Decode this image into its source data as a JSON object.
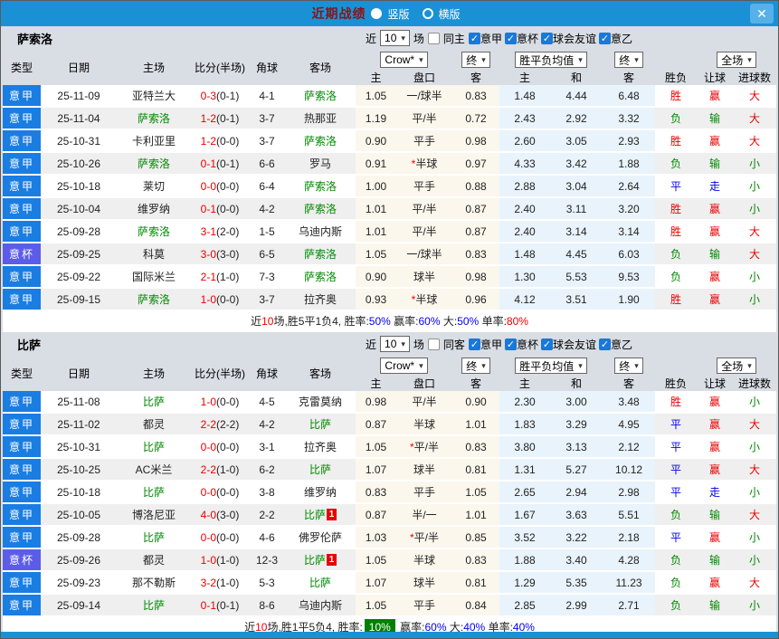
{
  "titlebar": {
    "title": "近期战绩",
    "radio_vertical": "竖版",
    "radio_horizontal": "横版"
  },
  "icons": {
    "close": "✕",
    "check": "✓",
    "caret": "▾"
  },
  "colors": {
    "titlebar_blue": "#1b91d5",
    "league_cell_blue": "#1a7de2",
    "cup_cell_purple": "#5c5ce8",
    "win_red": "#e80000",
    "lose_green": "#008800",
    "draw_blue": "#0000e8",
    "handicap_bg_cream": "#fbf7ed",
    "avg_bg_blue": "#e9f3fb",
    "rate_badge_green": "#008000"
  },
  "table_header": {
    "col_type": "类型",
    "col_date": "日期",
    "col_home": "主场",
    "col_score": "比分(半场)",
    "col_corner": "角球",
    "col_away": "客场",
    "sel_crow": "Crow*",
    "sel_final": "终",
    "sel_avg": "胜平负均值",
    "sel_final2": "终",
    "sel_full": "全场",
    "sub_home": "主",
    "sub_handicap": "盘口",
    "sub_away": "客",
    "sub_avg_home": "主",
    "sub_avg_draw": "和",
    "sub_avg_away": "客",
    "col_result": "胜负",
    "col_let": "让球",
    "col_goals": "进球数"
  },
  "sections": [
    {
      "team": "萨索洛",
      "filter": {
        "near": "近",
        "count": "10",
        "games": "场",
        "same": "同主",
        "same_checked": false,
        "leagues": [
          {
            "label": "意甲",
            "checked": true
          },
          {
            "label": "意杯",
            "checked": true
          },
          {
            "label": "球会友谊",
            "checked": true
          },
          {
            "label": "意乙",
            "checked": true
          }
        ]
      },
      "rows": [
        {
          "type": "意甲",
          "cup": false,
          "date": "25-11-09",
          "home": "亚特兰大",
          "home_c": "k",
          "home_badge": "",
          "score_ft": "0-3",
          "score_ht": "(0-1)",
          "corners": "4-1",
          "away": "萨索洛",
          "away_c": "g",
          "away_badge": "",
          "odds_home": "1.05",
          "handicap_star": "",
          "handicap": "一/球半",
          "odds_away": "0.83",
          "avg_win": "1.48",
          "avg_draw": "4.44",
          "avg_lose": "6.48",
          "result": "胜",
          "result_c": "r",
          "let_result": "赢",
          "let_c": "r",
          "goals": "大",
          "goals_c": "r"
        },
        {
          "type": "意甲",
          "cup": false,
          "date": "25-11-04",
          "home": "萨索洛",
          "home_c": "g",
          "home_badge": "",
          "score_ft": "1-2",
          "score_ht": "(0-1)",
          "corners": "3-7",
          "away": "热那亚",
          "away_c": "k",
          "away_badge": "",
          "odds_home": "1.19",
          "handicap_star": "",
          "handicap": "平/半",
          "odds_away": "0.72",
          "avg_win": "2.43",
          "avg_draw": "2.92",
          "avg_lose": "3.32",
          "result": "负",
          "result_c": "g",
          "let_result": "输",
          "let_c": "g",
          "goals": "大",
          "goals_c": "r"
        },
        {
          "type": "意甲",
          "cup": false,
          "date": "25-10-31",
          "home": "卡利亚里",
          "home_c": "k",
          "home_badge": "",
          "score_ft": "1-2",
          "score_ht": "(0-0)",
          "corners": "3-7",
          "away": "萨索洛",
          "away_c": "g",
          "away_badge": "",
          "odds_home": "0.90",
          "handicap_star": "",
          "handicap": "平手",
          "odds_away": "0.98",
          "avg_win": "2.60",
          "avg_draw": "3.05",
          "avg_lose": "2.93",
          "result": "胜",
          "result_c": "r",
          "let_result": "赢",
          "let_c": "r",
          "goals": "大",
          "goals_c": "r"
        },
        {
          "type": "意甲",
          "cup": false,
          "date": "25-10-26",
          "home": "萨索洛",
          "home_c": "g",
          "home_badge": "",
          "score_ft": "0-1",
          "score_ht": "(0-1)",
          "corners": "6-6",
          "away": "罗马",
          "away_c": "k",
          "away_badge": "",
          "odds_home": "0.91",
          "handicap_star": "*",
          "handicap": "半球",
          "odds_away": "0.97",
          "avg_win": "4.33",
          "avg_draw": "3.42",
          "avg_lose": "1.88",
          "result": "负",
          "result_c": "g",
          "let_result": "输",
          "let_c": "g",
          "goals": "小",
          "goals_c": "g"
        },
        {
          "type": "意甲",
          "cup": false,
          "date": "25-10-18",
          "home": "莱切",
          "home_c": "k",
          "home_badge": "",
          "score_ft": "0-0",
          "score_ht": "(0-0)",
          "corners": "6-4",
          "away": "萨索洛",
          "away_c": "g",
          "away_badge": "",
          "odds_home": "1.00",
          "handicap_star": "",
          "handicap": "平手",
          "odds_away": "0.88",
          "avg_win": "2.88",
          "avg_draw": "3.04",
          "avg_lose": "2.64",
          "result": "平",
          "result_c": "b",
          "let_result": "走",
          "let_c": "b",
          "goals": "小",
          "goals_c": "g"
        },
        {
          "type": "意甲",
          "cup": false,
          "date": "25-10-04",
          "home": "维罗纳",
          "home_c": "k",
          "home_badge": "",
          "score_ft": "0-1",
          "score_ht": "(0-0)",
          "corners": "4-2",
          "away": "萨索洛",
          "away_c": "g",
          "away_badge": "",
          "odds_home": "1.01",
          "handicap_star": "",
          "handicap": "平/半",
          "odds_away": "0.87",
          "avg_win": "2.40",
          "avg_draw": "3.11",
          "avg_lose": "3.20",
          "result": "胜",
          "result_c": "r",
          "let_result": "赢",
          "let_c": "r",
          "goals": "小",
          "goals_c": "g"
        },
        {
          "type": "意甲",
          "cup": false,
          "date": "25-09-28",
          "home": "萨索洛",
          "home_c": "g",
          "home_badge": "",
          "score_ft": "3-1",
          "score_ht": "(2-0)",
          "corners": "1-5",
          "away": "乌迪内斯",
          "away_c": "k",
          "away_badge": "",
          "odds_home": "1.01",
          "handicap_star": "",
          "handicap": "平/半",
          "odds_away": "0.87",
          "avg_win": "2.40",
          "avg_draw": "3.14",
          "avg_lose": "3.14",
          "result": "胜",
          "result_c": "r",
          "let_result": "赢",
          "let_c": "r",
          "goals": "大",
          "goals_c": "r"
        },
        {
          "type": "意杯",
          "cup": true,
          "date": "25-09-25",
          "home": "科莫",
          "home_c": "k",
          "home_badge": "",
          "score_ft": "3-0",
          "score_ht": "(3-0)",
          "corners": "6-5",
          "away": "萨索洛",
          "away_c": "g",
          "away_badge": "",
          "odds_home": "1.05",
          "handicap_star": "",
          "handicap": "一/球半",
          "odds_away": "0.83",
          "avg_win": "1.48",
          "avg_draw": "4.45",
          "avg_lose": "6.03",
          "result": "负",
          "result_c": "g",
          "let_result": "输",
          "let_c": "g",
          "goals": "大",
          "goals_c": "r"
        },
        {
          "type": "意甲",
          "cup": false,
          "date": "25-09-22",
          "home": "国际米兰",
          "home_c": "k",
          "home_badge": "",
          "score_ft": "2-1",
          "score_ht": "(1-0)",
          "corners": "7-3",
          "away": "萨索洛",
          "away_c": "g",
          "away_badge": "",
          "odds_home": "0.90",
          "handicap_star": "",
          "handicap": "球半",
          "odds_away": "0.98",
          "avg_win": "1.30",
          "avg_draw": "5.53",
          "avg_lose": "9.53",
          "result": "负",
          "result_c": "g",
          "let_result": "赢",
          "let_c": "r",
          "goals": "小",
          "goals_c": "g"
        },
        {
          "type": "意甲",
          "cup": false,
          "date": "25-09-15",
          "home": "萨索洛",
          "home_c": "g",
          "home_badge": "",
          "score_ft": "1-0",
          "score_ht": "(0-0)",
          "corners": "3-7",
          "away": "拉齐奥",
          "away_c": "k",
          "away_badge": "",
          "odds_home": "0.93",
          "handicap_star": "*",
          "handicap": "半球",
          "odds_away": "0.96",
          "avg_win": "4.12",
          "avg_draw": "3.51",
          "avg_lose": "1.90",
          "result": "胜",
          "result_c": "r",
          "let_result": "赢",
          "let_c": "r",
          "goals": "小",
          "goals_c": "g"
        }
      ],
      "summary": [
        {
          "text": "近",
          "c": "k"
        },
        {
          "text": "10",
          "c": "r"
        },
        {
          "text": "场,胜5平1负4, 胜率:",
          "c": "k"
        },
        {
          "text": "50%",
          "c": "b"
        },
        {
          "text": " 赢率:",
          "c": "k"
        },
        {
          "text": "60%",
          "c": "b"
        },
        {
          "text": " 大:",
          "c": "k"
        },
        {
          "text": "50%",
          "c": "b"
        },
        {
          "text": " 单率:",
          "c": "k"
        },
        {
          "text": "80%",
          "c": "r"
        }
      ]
    },
    {
      "team": "比萨",
      "filter": {
        "near": "近",
        "count": "10",
        "games": "场",
        "same": "同客",
        "same_checked": false,
        "leagues": [
          {
            "label": "意甲",
            "checked": true
          },
          {
            "label": "意杯",
            "checked": true
          },
          {
            "label": "球会友谊",
            "checked": true
          },
          {
            "label": "意乙",
            "checked": true
          }
        ]
      },
      "rows": [
        {
          "type": "意甲",
          "cup": false,
          "date": "25-11-08",
          "home": "比萨",
          "home_c": "g",
          "home_badge": "",
          "score_ft": "1-0",
          "score_ht": "(0-0)",
          "corners": "4-5",
          "away": "克雷莫纳",
          "away_c": "k",
          "away_badge": "",
          "odds_home": "0.98",
          "handicap_star": "",
          "handicap": "平/半",
          "odds_away": "0.90",
          "avg_win": "2.30",
          "avg_draw": "3.00",
          "avg_lose": "3.48",
          "result": "胜",
          "result_c": "r",
          "let_result": "赢",
          "let_c": "r",
          "goals": "小",
          "goals_c": "g"
        },
        {
          "type": "意甲",
          "cup": false,
          "date": "25-11-02",
          "home": "都灵",
          "home_c": "k",
          "home_badge": "",
          "score_ft": "2-2",
          "score_ht": "(2-2)",
          "corners": "4-2",
          "away": "比萨",
          "away_c": "g",
          "away_badge": "",
          "odds_home": "0.87",
          "handicap_star": "",
          "handicap": "半球",
          "odds_away": "1.01",
          "avg_win": "1.83",
          "avg_draw": "3.29",
          "avg_lose": "4.95",
          "result": "平",
          "result_c": "b",
          "let_result": "赢",
          "let_c": "r",
          "goals": "大",
          "goals_c": "r"
        },
        {
          "type": "意甲",
          "cup": false,
          "date": "25-10-31",
          "home": "比萨",
          "home_c": "g",
          "home_badge": "",
          "score_ft": "0-0",
          "score_ht": "(0-0)",
          "corners": "3-1",
          "away": "拉齐奥",
          "away_c": "k",
          "away_badge": "",
          "odds_home": "1.05",
          "handicap_star": "*",
          "handicap": "平/半",
          "odds_away": "0.83",
          "avg_win": "3.80",
          "avg_draw": "3.13",
          "avg_lose": "2.12",
          "result": "平",
          "result_c": "b",
          "let_result": "赢",
          "let_c": "r",
          "goals": "小",
          "goals_c": "g"
        },
        {
          "type": "意甲",
          "cup": false,
          "date": "25-10-25",
          "home": "AC米兰",
          "home_c": "k",
          "home_badge": "",
          "score_ft": "2-2",
          "score_ht": "(1-0)",
          "corners": "6-2",
          "away": "比萨",
          "away_c": "g",
          "away_badge": "",
          "odds_home": "1.07",
          "handicap_star": "",
          "handicap": "球半",
          "odds_away": "0.81",
          "avg_win": "1.31",
          "avg_draw": "5.27",
          "avg_lose": "10.12",
          "result": "平",
          "result_c": "b",
          "let_result": "赢",
          "let_c": "r",
          "goals": "大",
          "goals_c": "r"
        },
        {
          "type": "意甲",
          "cup": false,
          "date": "25-10-18",
          "home": "比萨",
          "home_c": "g",
          "home_badge": "",
          "score_ft": "0-0",
          "score_ht": "(0-0)",
          "corners": "3-8",
          "away": "维罗纳",
          "away_c": "k",
          "away_badge": "",
          "odds_home": "0.83",
          "handicap_star": "",
          "handicap": "平手",
          "odds_away": "1.05",
          "avg_win": "2.65",
          "avg_draw": "2.94",
          "avg_lose": "2.98",
          "result": "平",
          "result_c": "b",
          "let_result": "走",
          "let_c": "b",
          "goals": "小",
          "goals_c": "g"
        },
        {
          "type": "意甲",
          "cup": false,
          "date": "25-10-05",
          "home": "博洛尼亚",
          "home_c": "k",
          "home_badge": "",
          "score_ft": "4-0",
          "score_ht": "(3-0)",
          "corners": "2-2",
          "away": "比萨",
          "away_c": "g",
          "away_badge": "1",
          "odds_home": "0.87",
          "handicap_star": "",
          "handicap": "半/一",
          "odds_away": "1.01",
          "avg_win": "1.67",
          "avg_draw": "3.63",
          "avg_lose": "5.51",
          "result": "负",
          "result_c": "g",
          "let_result": "输",
          "let_c": "g",
          "goals": "大",
          "goals_c": "r"
        },
        {
          "type": "意甲",
          "cup": false,
          "date": "25-09-28",
          "home": "比萨",
          "home_c": "g",
          "home_badge": "",
          "score_ft": "0-0",
          "score_ht": "(0-0)",
          "corners": "4-6",
          "away": "佛罗伦萨",
          "away_c": "k",
          "away_badge": "",
          "odds_home": "1.03",
          "handicap_star": "*",
          "handicap": "平/半",
          "odds_away": "0.85",
          "avg_win": "3.52",
          "avg_draw": "3.22",
          "avg_lose": "2.18",
          "result": "平",
          "result_c": "b",
          "let_result": "赢",
          "let_c": "r",
          "goals": "小",
          "goals_c": "g"
        },
        {
          "type": "意杯",
          "cup": true,
          "date": "25-09-26",
          "home": "都灵",
          "home_c": "k",
          "home_badge": "",
          "score_ft": "1-0",
          "score_ht": "(1-0)",
          "corners": "12-3",
          "away": "比萨",
          "away_c": "g",
          "away_badge": "1",
          "odds_home": "1.05",
          "handicap_star": "",
          "handicap": "半球",
          "odds_away": "0.83",
          "avg_win": "1.88",
          "avg_draw": "3.40",
          "avg_lose": "4.28",
          "result": "负",
          "result_c": "g",
          "let_result": "输",
          "let_c": "g",
          "goals": "小",
          "goals_c": "g"
        },
        {
          "type": "意甲",
          "cup": false,
          "date": "25-09-23",
          "home": "那不勒斯",
          "home_c": "k",
          "home_badge": "",
          "score_ft": "3-2",
          "score_ht": "(1-0)",
          "corners": "5-3",
          "away": "比萨",
          "away_c": "g",
          "away_badge": "",
          "odds_home": "1.07",
          "handicap_star": "",
          "handicap": "球半",
          "odds_away": "0.81",
          "avg_win": "1.29",
          "avg_draw": "5.35",
          "avg_lose": "11.23",
          "result": "负",
          "result_c": "g",
          "let_result": "赢",
          "let_c": "r",
          "goals": "大",
          "goals_c": "r"
        },
        {
          "type": "意甲",
          "cup": false,
          "date": "25-09-14",
          "home": "比萨",
          "home_c": "g",
          "home_badge": "",
          "score_ft": "0-1",
          "score_ht": "(0-1)",
          "corners": "8-6",
          "away": "乌迪内斯",
          "away_c": "k",
          "away_badge": "",
          "odds_home": "1.05",
          "handicap_star": "",
          "handicap": "平手",
          "odds_away": "0.84",
          "avg_win": "2.85",
          "avg_draw": "2.99",
          "avg_lose": "2.71",
          "result": "负",
          "result_c": "g",
          "let_result": "输",
          "let_c": "g",
          "goals": "小",
          "goals_c": "g"
        }
      ],
      "summary": [
        {
          "text": "近",
          "c": "k"
        },
        {
          "text": "10",
          "c": "r"
        },
        {
          "text": "场,胜1平5负4, 胜率:",
          "c": "k"
        },
        {
          "text": "10%",
          "c": "wg"
        },
        {
          "text": " 赢率:",
          "c": "k"
        },
        {
          "text": "60%",
          "c": "b"
        },
        {
          "text": " 大:",
          "c": "k"
        },
        {
          "text": "40%",
          "c": "b"
        },
        {
          "text": " 单率:",
          "c": "k"
        },
        {
          "text": "40%",
          "c": "b"
        }
      ]
    }
  ]
}
